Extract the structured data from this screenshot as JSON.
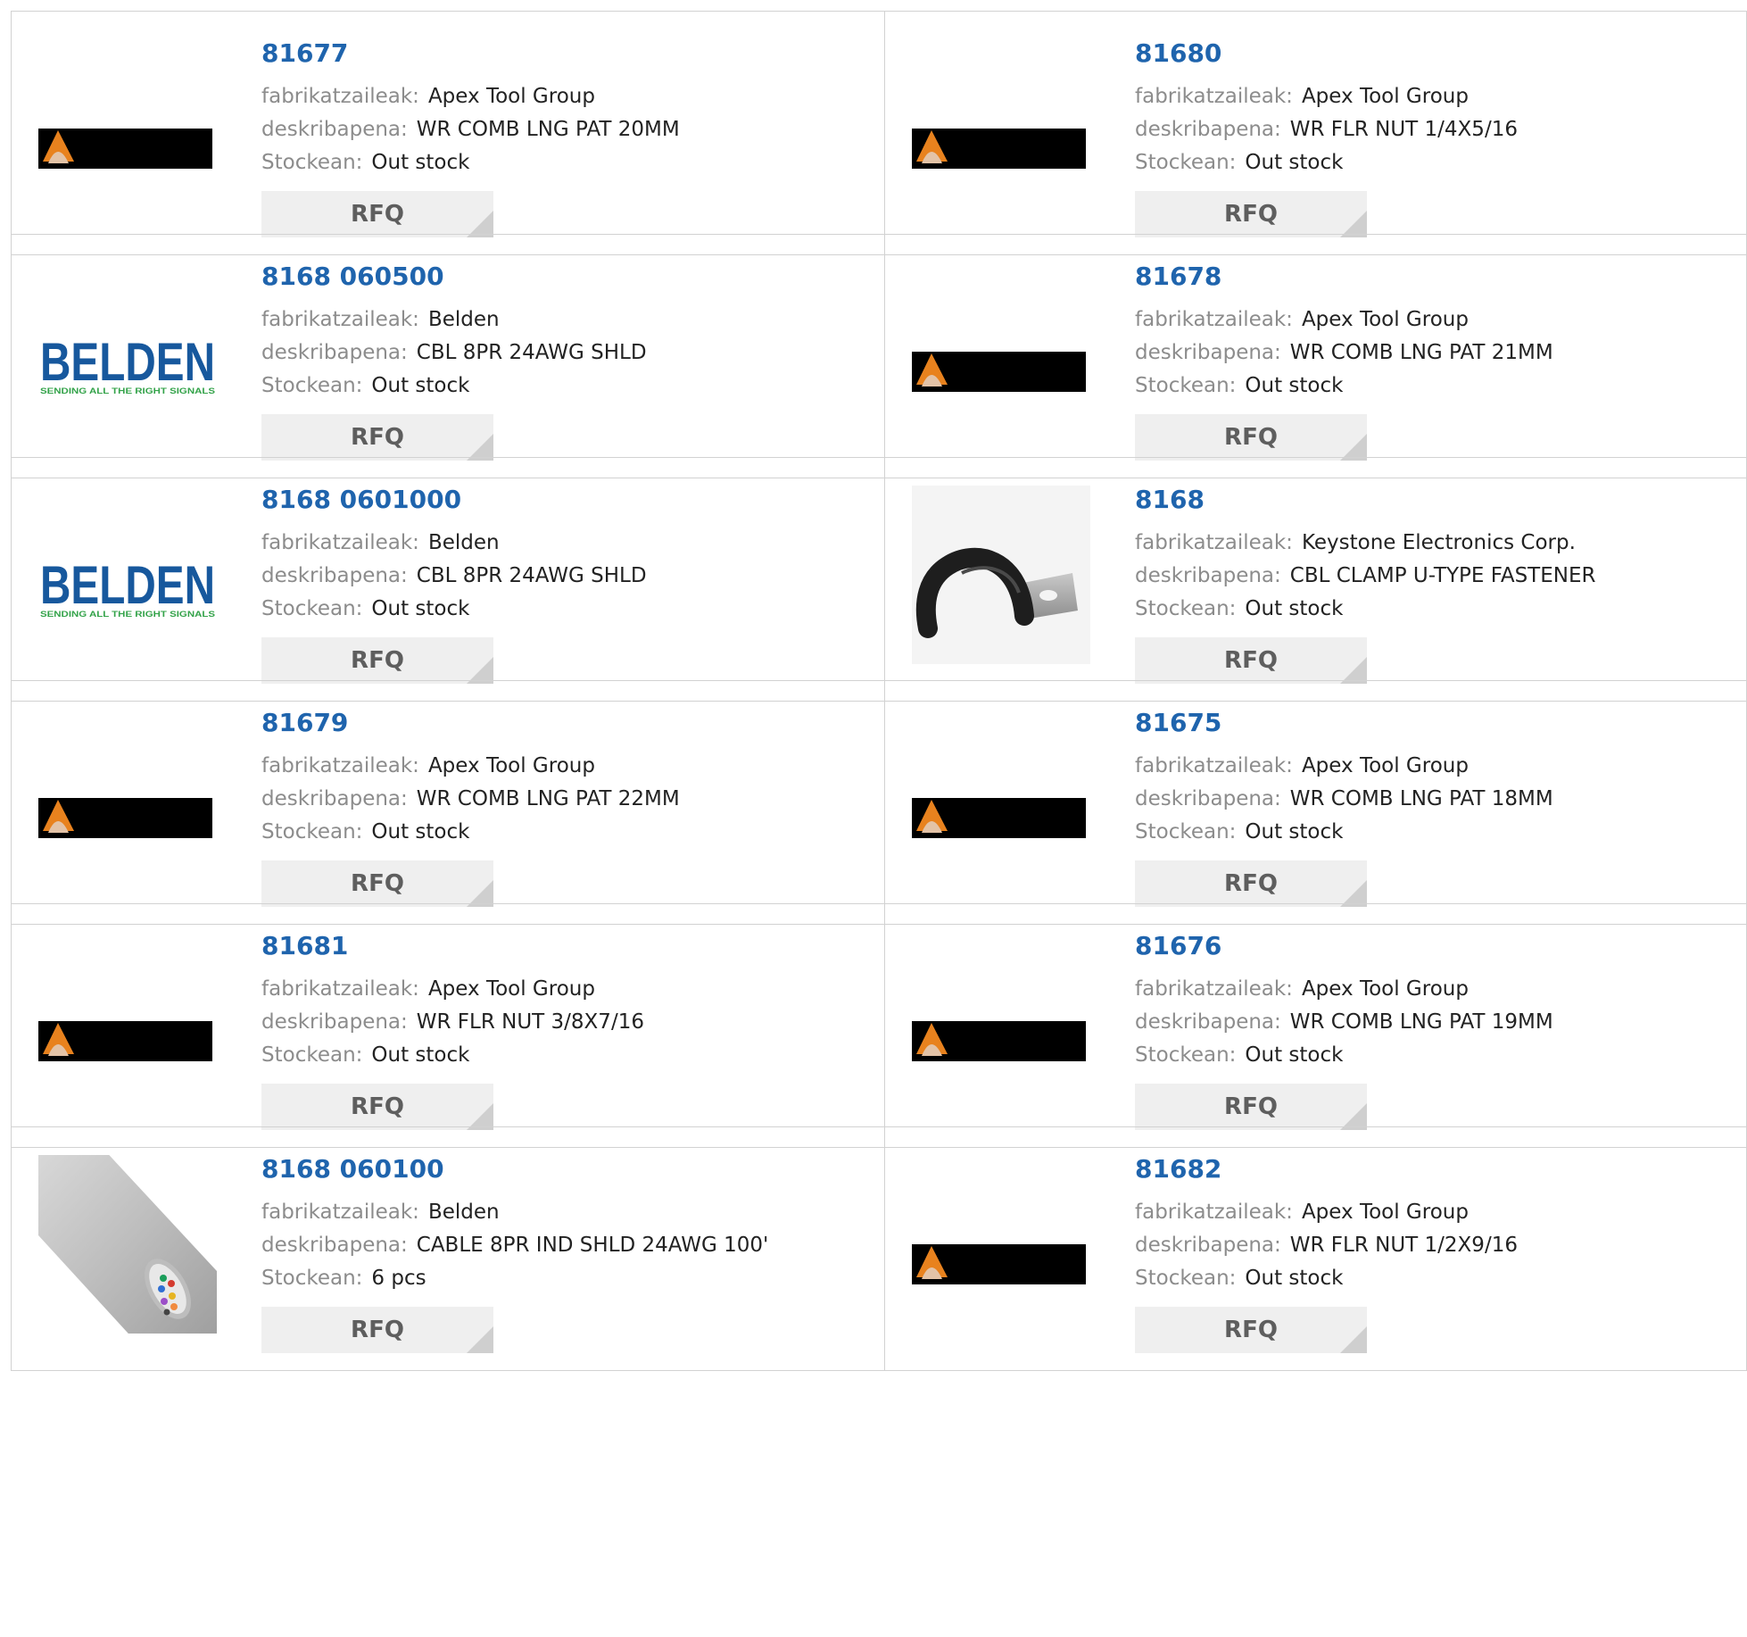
{
  "labels": {
    "manufacturer": "fabrikatzaileak:",
    "description": "deskribapena:",
    "stock": "Stockean:",
    "rfq": "RFQ"
  },
  "colors": {
    "part_number": "#1f64ad",
    "label": "#8c8c8c",
    "rfq_bg": "#efefef",
    "border": "#d2d2d2"
  },
  "products": [
    {
      "part_number": "81677",
      "manufacturer": "Apex Tool Group",
      "description": "WR COMB LNG PAT 20MM",
      "stock": "Out stock",
      "image": "apex-logo"
    },
    {
      "part_number": "81680",
      "manufacturer": "Apex Tool Group",
      "description": "WR FLR NUT 1/4X5/16",
      "stock": "Out stock",
      "image": "apex-logo"
    },
    {
      "part_number": "8168 060500",
      "manufacturer": "Belden",
      "description": "CBL 8PR 24AWG SHLD",
      "stock": "Out stock",
      "image": "belden-logo"
    },
    {
      "part_number": "81678",
      "manufacturer": "Apex Tool Group",
      "description": "WR COMB LNG PAT 21MM",
      "stock": "Out stock",
      "image": "apex-logo"
    },
    {
      "part_number": "8168 0601000",
      "manufacturer": "Belden",
      "description": "CBL 8PR 24AWG SHLD",
      "stock": "Out stock",
      "image": "belden-logo"
    },
    {
      "part_number": "8168",
      "manufacturer": "Keystone Electronics Corp.",
      "description": "CBL CLAMP U-TYPE FASTENER",
      "stock": "Out stock",
      "image": "cable-clamp"
    },
    {
      "part_number": "81679",
      "manufacturer": "Apex Tool Group",
      "description": "WR COMB LNG PAT 22MM",
      "stock": "Out stock",
      "image": "apex-logo"
    },
    {
      "part_number": "81675",
      "manufacturer": "Apex Tool Group",
      "description": "WR COMB LNG PAT 18MM",
      "stock": "Out stock",
      "image": "apex-logo"
    },
    {
      "part_number": "81681",
      "manufacturer": "Apex Tool Group",
      "description": "WR FLR NUT 3/8X7/16",
      "stock": "Out stock",
      "image": "apex-logo"
    },
    {
      "part_number": "81676",
      "manufacturer": "Apex Tool Group",
      "description": "WR COMB LNG PAT 19MM",
      "stock": "Out stock",
      "image": "apex-logo"
    },
    {
      "part_number": "8168 060100",
      "manufacturer": "Belden",
      "description": "CABLE 8PR IND SHLD 24AWG 100'",
      "stock": "6 pcs",
      "image": "gray-cable"
    },
    {
      "part_number": "81682",
      "manufacturer": "Apex Tool Group",
      "description": "WR FLR NUT 1/2X9/16",
      "stock": "Out stock",
      "image": "apex-logo"
    }
  ]
}
